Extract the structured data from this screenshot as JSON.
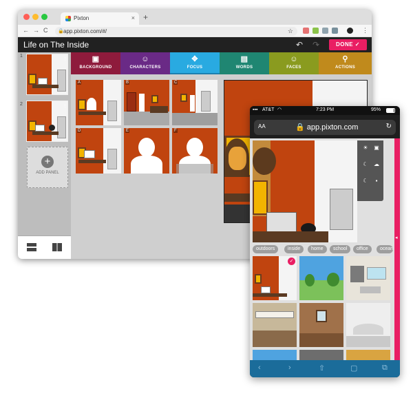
{
  "browser": {
    "tab_title": "Pixton",
    "tab_close": "×",
    "new_tab": "+",
    "back": "←",
    "forward": "→",
    "reload": "C",
    "url": "app.pixton.com/#/",
    "star": "☆",
    "menu": "⋮"
  },
  "app": {
    "title": "Life on The Inside",
    "undo": "↶",
    "redo": "↷",
    "done_label": "DONE ✓",
    "add_panel_label": "ADD PANEL",
    "add_panel_plus": "+",
    "panel_numbers": [
      "1",
      "2"
    ],
    "toolbar": [
      {
        "label": "BACKGROUND",
        "icon": "image-icon",
        "glyph": "▣",
        "color": "#8e1b3c"
      },
      {
        "label": "CHARACTERS",
        "icon": "smiley-icon",
        "glyph": "☺",
        "color": "#6a2a86"
      },
      {
        "label": "FOCUS",
        "icon": "move-icon",
        "glyph": "✥",
        "color": "#29aae1"
      },
      {
        "label": "WORDS",
        "icon": "speech-bubble-icon",
        "glyph": "▤",
        "color": "#1f8672"
      },
      {
        "label": "FACES",
        "icon": "face-icon",
        "glyph": "☺",
        "color": "#8a9b1f"
      },
      {
        "label": "ACTIONS",
        "icon": "running-figure-icon",
        "glyph": "⚲",
        "color": "#c08a1c"
      }
    ],
    "grid_letters": [
      "A",
      "B",
      "C",
      "D",
      "E",
      "F"
    ]
  },
  "phone": {
    "carrier": "AT&T",
    "time": "7:23 PM",
    "battery": "95%",
    "aa": "AA",
    "url": "🔒 app.pixton.com",
    "reload": "↻",
    "categories": [
      "outdoors",
      "inside",
      "home",
      "school",
      "office",
      "ocean"
    ],
    "nav": [
      "‹",
      "›",
      "⇧",
      "▢",
      "⧉"
    ]
  },
  "colors": {
    "accent": "#e91e63",
    "scene_wall": "#c0440f",
    "app_header": "#212121",
    "phone_tabbar": "#1b6c9a"
  }
}
